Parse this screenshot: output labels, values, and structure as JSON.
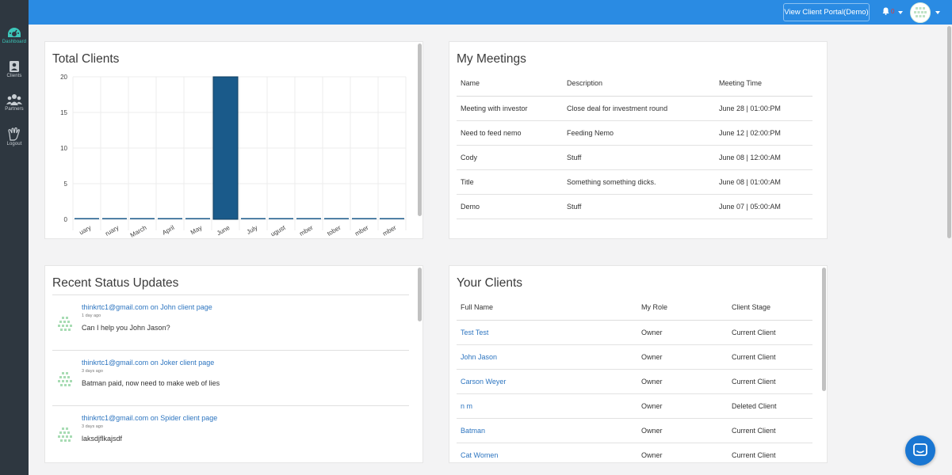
{
  "sidebar": {
    "items": [
      {
        "label": "Dashboard",
        "icon": "dashboard-icon",
        "active": true
      },
      {
        "label": "Clients",
        "icon": "clients-icon",
        "active": false
      },
      {
        "label": "Partners",
        "icon": "partners-icon",
        "active": false
      },
      {
        "label": "Logout",
        "icon": "logout-icon",
        "active": false
      }
    ]
  },
  "topbar": {
    "portal_button": "View Client Portal(Demo)",
    "notification_count": "0"
  },
  "total_clients": {
    "title": "Total Clients"
  },
  "chart_data": {
    "type": "bar",
    "categories": [
      "January",
      "February",
      "March",
      "April",
      "May",
      "June",
      "July",
      "August",
      "September",
      "October",
      "November",
      "December"
    ],
    "visible_tick_labels": [
      "uary",
      "ruary",
      "March",
      "April",
      "May",
      "June",
      "July",
      "ugust",
      "mber",
      "tober",
      "mber",
      "mber"
    ],
    "values": [
      0,
      0,
      0,
      0,
      0,
      20,
      0,
      0,
      0,
      0,
      0,
      0
    ],
    "yticks": [
      "20",
      "15",
      "10",
      "5",
      "0"
    ],
    "ylim": [
      0,
      20
    ],
    "grid": true,
    "color": "#1a5a8a"
  },
  "meetings": {
    "title": "My Meetings",
    "columns": [
      "Name",
      "Description",
      "Meeting Time"
    ],
    "rows": [
      [
        "Meeting with investor",
        "Close deal for investment round",
        "June 28 | 01:00:PM"
      ],
      [
        "Need to feed nemo",
        "Feeding Nemo",
        "June 12 | 02:00:PM"
      ],
      [
        "Cody",
        "Stuff",
        "June 08 | 12:00:AM"
      ],
      [
        "Title",
        "Something something dicks.",
        "June 08 | 01:00:AM"
      ],
      [
        "Demo",
        "Stuff",
        "June 07 | 05:00:AM"
      ]
    ]
  },
  "status": {
    "title": "Recent Status Updates",
    "items": [
      {
        "user": "thinkrtc1@gmail.com",
        "on": "on",
        "page": "John client page",
        "time": "1 day ago",
        "message": "Can I help you John Jason?"
      },
      {
        "user": "thinkrtc1@gmail.com",
        "on": "on",
        "page": "Joker client page",
        "time": "3 days ago",
        "message": "Batman paid, now need to make web of lies"
      },
      {
        "user": "thinkrtc1@gmail.com",
        "on": "on",
        "page": "Spider client page",
        "time": "3 days ago",
        "message": "laksdjflkajsdf"
      }
    ]
  },
  "clients": {
    "title": "Your Clients",
    "columns": [
      "Full Name",
      "My Role",
      "Client Stage"
    ],
    "rows": [
      [
        "Test Test",
        "Owner",
        "Current Client"
      ],
      [
        "John Jason",
        "Owner",
        "Current Client"
      ],
      [
        "Carson Weyer",
        "Owner",
        "Current Client"
      ],
      [
        "n m",
        "Owner",
        "Deleted Client"
      ],
      [
        "Batman",
        "Owner",
        "Current Client"
      ],
      [
        "Cat Women",
        "Owner",
        "Current Client"
      ]
    ]
  },
  "colors": {
    "topbar": "#2a8be3",
    "sidebar": "#2e3740",
    "accent": "#3cc7ba",
    "link": "#2d75c0",
    "bar": "#1a5a8a"
  }
}
